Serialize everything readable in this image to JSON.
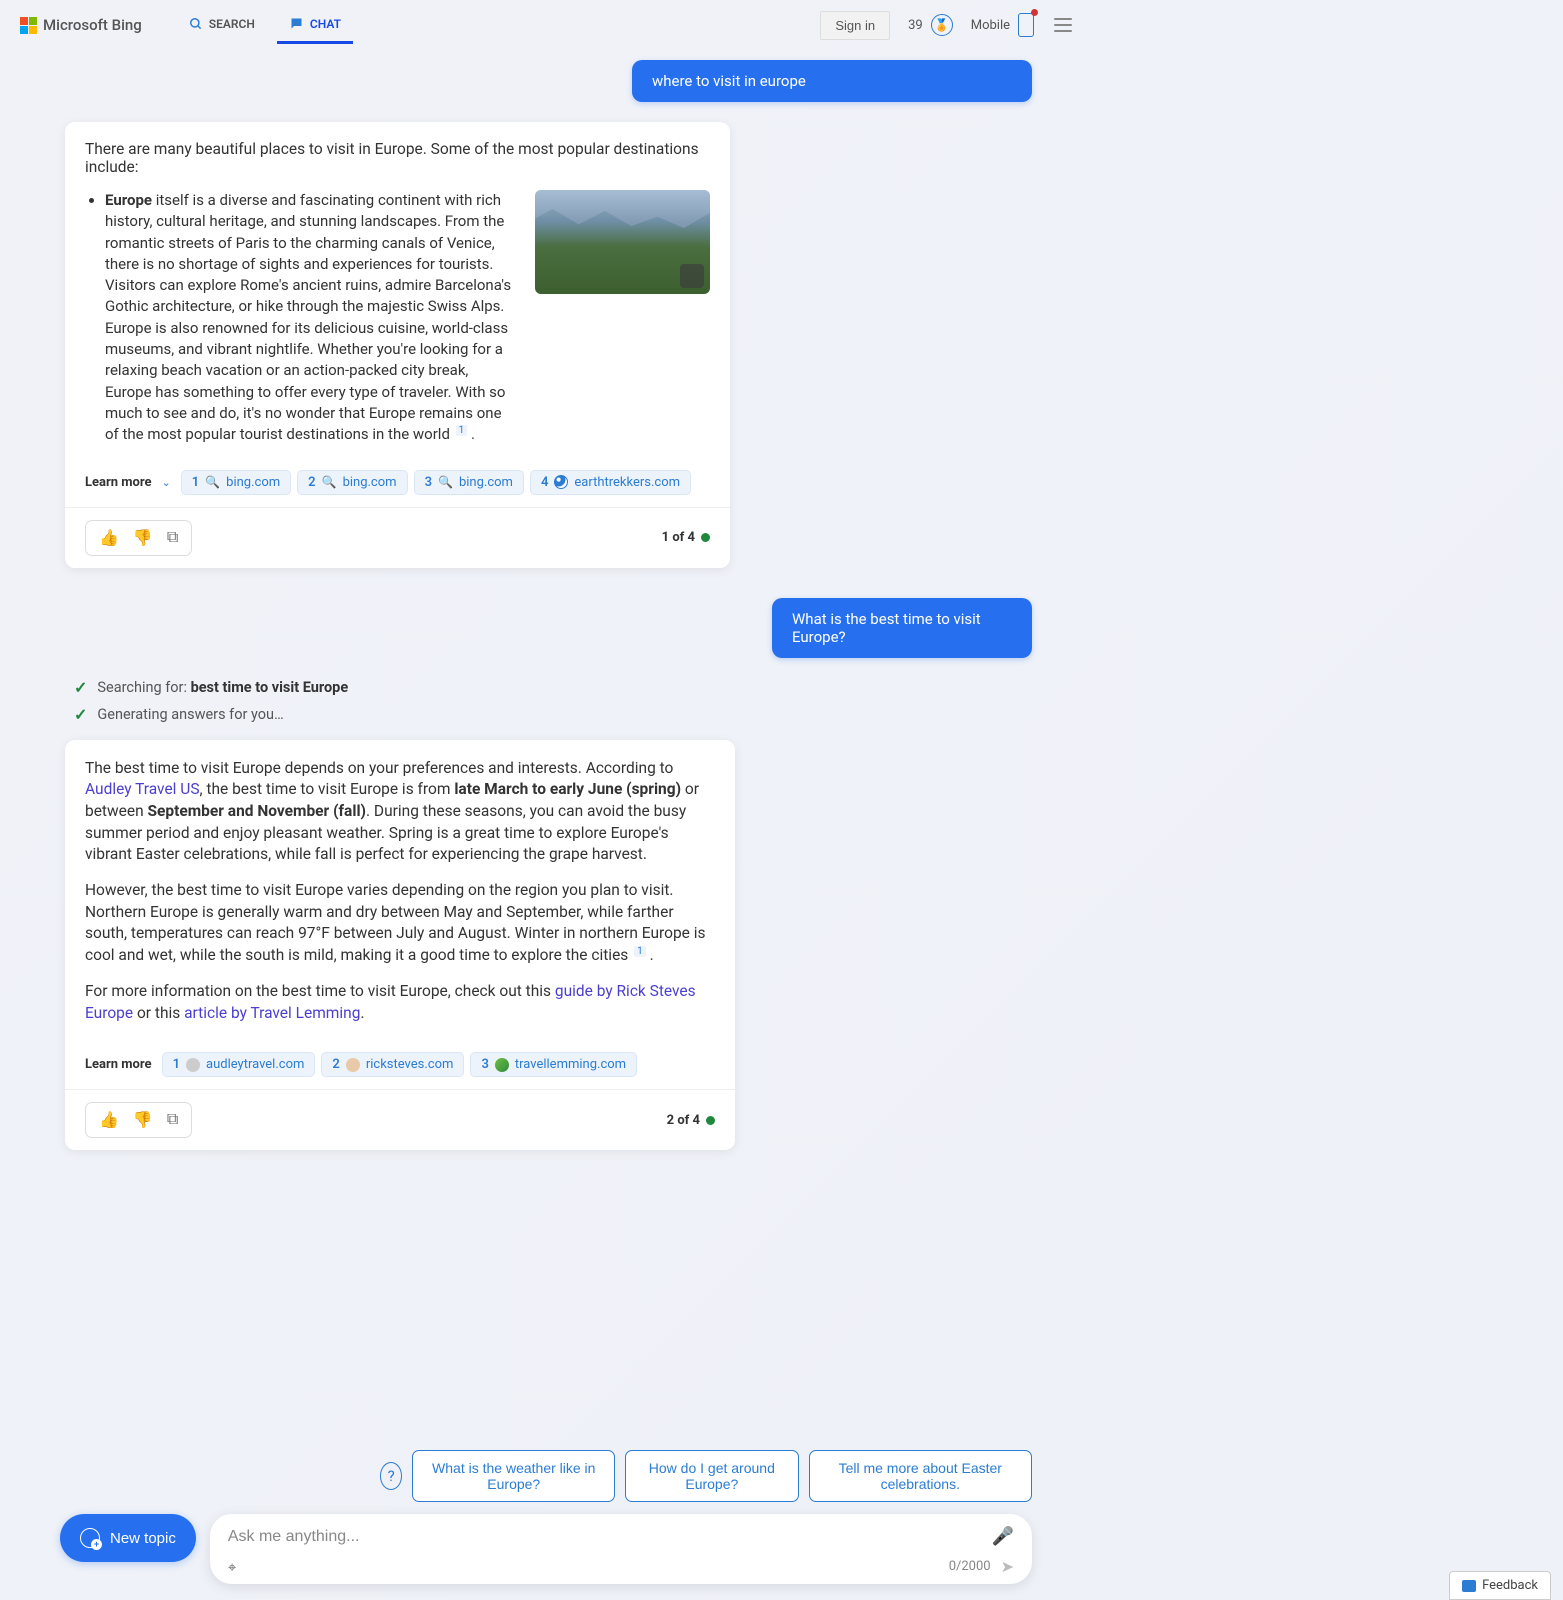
{
  "brand": {
    "name": "Microsoft Bing"
  },
  "nav": {
    "search": "SEARCH",
    "chat": "CHAT"
  },
  "header": {
    "signin": "Sign in",
    "rewards": "39",
    "mobile": "Mobile"
  },
  "user_messages": {
    "m1": "where to visit in europe",
    "m2": "What is the best time to visit Europe?"
  },
  "card1": {
    "intro": "There are many beautiful places to visit in Europe. Some of the most popular destinations include:",
    "bullet_bold": "Europe",
    "bullet_rest": " itself is a diverse and fascinating continent with rich history, cultural heritage, and stunning landscapes. From the romantic streets of Paris to the charming canals of Venice, there is no shortage of sights and experiences for tourists. Visitors can explore Rome's ancient ruins, admire Barcelona's Gothic architecture, or hike through the majestic Swiss Alps. Europe is also renowned for its delicious cuisine, world-class museums, and vibrant nightlife. Whether you're looking for a relaxing beach vacation or an action-packed city break, Europe has something to offer every type of traveler. With so much to see and do, it's no wonder that Europe remains one of the most popular tourist destinations in the world ",
    "sup": "1",
    "period": " .",
    "learn_more": "Learn more",
    "cites": [
      {
        "n": "1",
        "site": "bing.com",
        "fav": "search"
      },
      {
        "n": "2",
        "site": "bing.com",
        "fav": "search"
      },
      {
        "n": "3",
        "site": "bing.com",
        "fav": "search"
      },
      {
        "n": "4",
        "site": "earthtrekkers.com",
        "fav": "blue"
      }
    ],
    "counter": "1 of 4"
  },
  "status": {
    "searching_prefix": "Searching for: ",
    "searching_term": "best time to visit Europe",
    "generating": "Generating answers for you…"
  },
  "card2": {
    "p1_a": "The best time to visit Europe depends on your preferences and interests. According to ",
    "p1_link1": "Audley Travel US",
    "p1_b": ", the best time to visit Europe is from ",
    "p1_bold1": "late March to early June (spring)",
    "p1_c": " or between ",
    "p1_bold2": "September and November (fall)",
    "p1_d": ". During these seasons, you can avoid the busy summer period and enjoy pleasant weather. Spring is a great time to explore Europe's vibrant Easter celebrations, while fall is perfect for experiencing the grape harvest.",
    "p2_a": "However, the best time to visit Europe varies depending on the region you plan to visit. Northern Europe is generally warm and dry between May and September, while farther south, temperatures can reach 97°F between July and August. Winter in northern Europe is cool and wet, while the south is mild, making it a good time to explore the cities ",
    "p2_sup": "1",
    "p2_b": " .",
    "p3_a": "For more information on the best time to visit Europe, check out this ",
    "p3_link1": "guide by Rick Steves Europe",
    "p3_b": " or this ",
    "p3_link2": "article by Travel Lemming",
    "p3_c": ".",
    "learn_more": "Learn more",
    "cites": [
      {
        "n": "1",
        "site": "audleytravel.com",
        "fav": "grey"
      },
      {
        "n": "2",
        "site": "ricksteves.com",
        "fav": "face"
      },
      {
        "n": "3",
        "site": "travellemming.com",
        "fav": "green"
      }
    ],
    "counter": "2 of 4"
  },
  "suggestions": {
    "s1": "What is the weather like in Europe?",
    "s2": "How do I get around Europe?",
    "s3": "Tell me more about Easter celebrations."
  },
  "composer": {
    "new_topic": "New topic",
    "placeholder": "Ask me anything...",
    "count": "0/2000"
  },
  "feedback": "Feedback"
}
